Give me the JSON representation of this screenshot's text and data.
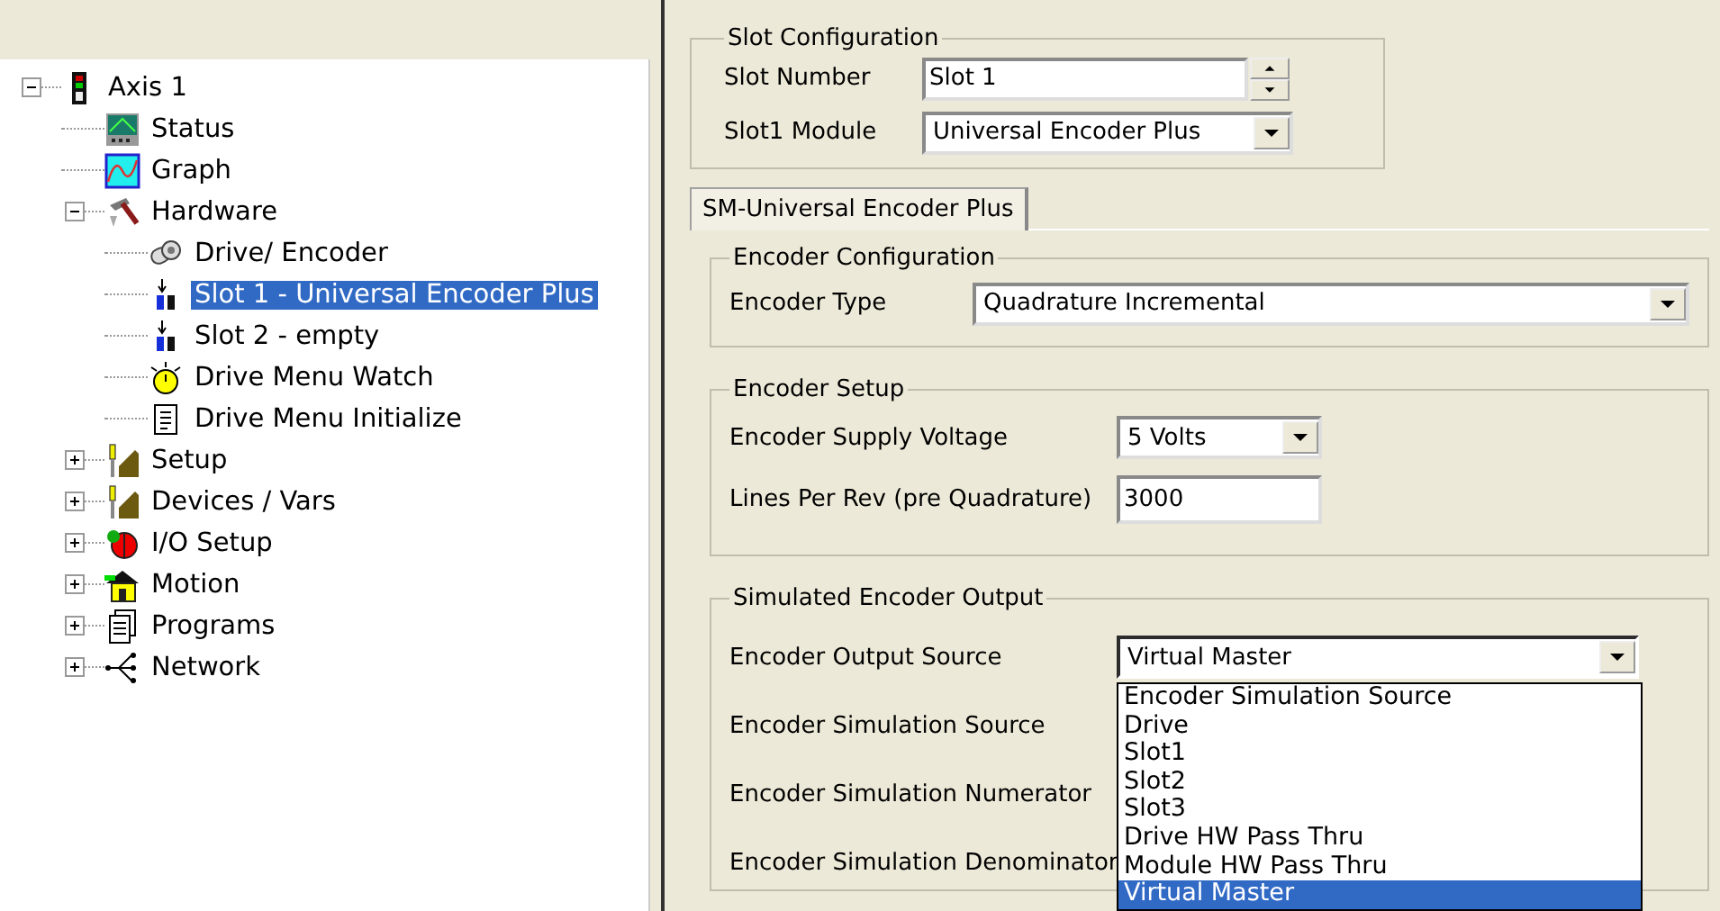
{
  "tree": [
    {
      "label": "Axis 1",
      "kind": "axis",
      "selected": false,
      "expanded": true,
      "children": [
        {
          "label": "Status",
          "kind": "status",
          "selected": false
        },
        {
          "label": "Graph",
          "kind": "graph",
          "selected": false
        },
        {
          "label": "Hardware",
          "kind": "hardware",
          "selected": false,
          "expanded": true,
          "children": [
            {
              "label": "Drive/ Encoder",
              "kind": "drive",
              "selected": false
            },
            {
              "label": "Slot 1 - Universal Encoder Plus",
              "kind": "slot",
              "selected": true
            },
            {
              "label": "Slot 2 - empty",
              "kind": "slot",
              "selected": false
            },
            {
              "label": "Drive Menu Watch",
              "kind": "watch",
              "selected": false
            },
            {
              "label": "Drive Menu Initialize",
              "kind": "document",
              "selected": false
            }
          ]
        },
        {
          "label": "Setup",
          "kind": "setup",
          "selected": false,
          "expanded": false
        },
        {
          "label": "Devices / Vars",
          "kind": "setup",
          "selected": false,
          "expanded": false
        },
        {
          "label": "I/O Setup",
          "kind": "io",
          "selected": false,
          "expanded": false
        },
        {
          "label": "Motion",
          "kind": "motion",
          "selected": false,
          "expanded": false
        },
        {
          "label": "Programs",
          "kind": "programs",
          "selected": false,
          "expanded": false
        },
        {
          "label": "Network",
          "kind": "network",
          "selected": false,
          "expanded": false
        }
      ]
    }
  ],
  "slot_configuration": {
    "title": "Slot Configuration",
    "slot_number": {
      "label": "Slot Number",
      "value": "Slot 1"
    },
    "module": {
      "label": "Slot1 Module",
      "value": "Universal Encoder Plus"
    }
  },
  "tabs": [
    {
      "label": "SM-Universal Encoder Plus",
      "selected": true
    }
  ],
  "encoder_configuration": {
    "title": "Encoder Configuration",
    "encoder_type": {
      "label": "Encoder Type",
      "value": "Quadrature Incremental"
    }
  },
  "encoder_setup": {
    "title": "Encoder Setup",
    "supply_voltage": {
      "label": "Encoder Supply Voltage",
      "value": "5 Volts"
    },
    "lines_per_rev": {
      "label": "Lines Per Rev (pre Quadrature)",
      "value": "3000"
    }
  },
  "simulated_output": {
    "title": "Simulated Encoder Output",
    "output_source": {
      "label": "Encoder Output Source",
      "value": "Virtual Master",
      "open": true,
      "options": [
        {
          "label": "Encoder Simulation Source",
          "selected": false
        },
        {
          "label": "Drive",
          "selected": false
        },
        {
          "label": "Slot1",
          "selected": false
        },
        {
          "label": "Slot2",
          "selected": false
        },
        {
          "label": "Slot3",
          "selected": false
        },
        {
          "label": "Drive HW Pass Thru",
          "selected": false
        },
        {
          "label": "Module HW Pass Thru",
          "selected": false
        },
        {
          "label": "Virtual Master",
          "selected": true
        }
      ]
    },
    "other_labels": [
      "Encoder Simulation Source",
      "Encoder Simulation Numerator",
      "Encoder Simulation Denominator"
    ]
  }
}
